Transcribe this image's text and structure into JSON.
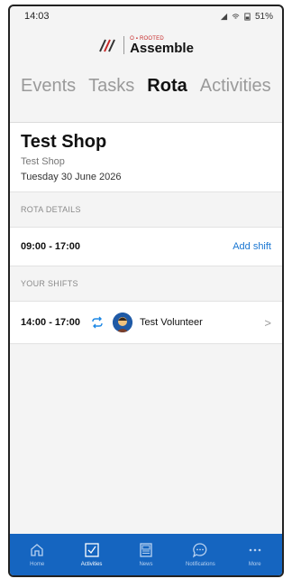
{
  "status_bar": {
    "time": "14:03",
    "battery": "51%"
  },
  "brand": {
    "sub": "O ▪ ROOTED",
    "name": "Assemble"
  },
  "tabs": [
    {
      "label": "Events",
      "active": false
    },
    {
      "label": "Tasks",
      "active": false
    },
    {
      "label": "Rota",
      "active": true
    },
    {
      "label": "Activities",
      "active": false
    }
  ],
  "shop": {
    "title": "Test Shop",
    "subtitle": "Test Shop",
    "date": "Tuesday 30 June 2026"
  },
  "rota_details": {
    "section_label": "ROTA DETAILS",
    "time": "09:00 - 17:00",
    "add_shift_label": "Add shift"
  },
  "your_shifts": {
    "section_label": "YOUR SHIFTS",
    "shifts": [
      {
        "time": "14:00 - 17:00",
        "volunteer": "Test Volunteer",
        "icon": "repeat-icon"
      }
    ]
  },
  "bottom_nav": [
    {
      "label": "Home",
      "icon": "home-icon",
      "active": false
    },
    {
      "label": "Activities",
      "icon": "checkbox-icon",
      "active": true
    },
    {
      "label": "News",
      "icon": "news-icon",
      "active": false
    },
    {
      "label": "Notifications",
      "icon": "chat-bubble-icon",
      "active": false
    },
    {
      "label": "More",
      "icon": "more-dots-icon",
      "active": false
    }
  ],
  "colors": {
    "accent": "#1976d2",
    "nav_background": "#1565c0",
    "repeat_icon": "#1e88e5",
    "brand_red": "#c62828"
  }
}
